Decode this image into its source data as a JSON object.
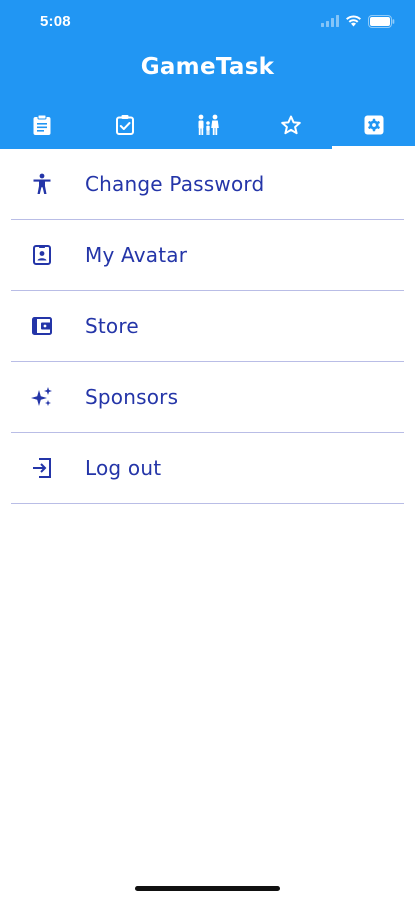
{
  "status_bar": {
    "time": "5:08"
  },
  "app": {
    "title": "GameTask"
  },
  "tabs": [
    {
      "id": "tasks",
      "icon": "clipboard-icon",
      "selected": false
    },
    {
      "id": "completed",
      "icon": "check-box-icon",
      "selected": false
    },
    {
      "id": "family",
      "icon": "family-icon",
      "selected": false
    },
    {
      "id": "favorites",
      "icon": "star-outline-icon",
      "selected": false
    },
    {
      "id": "settings",
      "icon": "settings-icon",
      "selected": true
    }
  ],
  "menu": {
    "items": [
      {
        "label": "Change Password",
        "icon": "accessibility-person-icon"
      },
      {
        "label": "My Avatar",
        "icon": "badge-icon"
      },
      {
        "label": "Store",
        "icon": "wallet-icon"
      },
      {
        "label": "Sponsors",
        "icon": "sparkles-icon"
      },
      {
        "label": "Log out",
        "icon": "logout-icon"
      }
    ]
  },
  "colors": {
    "primary": "#2196F3",
    "menu_text": "#2435a8",
    "divider": "#b9bde6",
    "background": "#ffffff"
  }
}
